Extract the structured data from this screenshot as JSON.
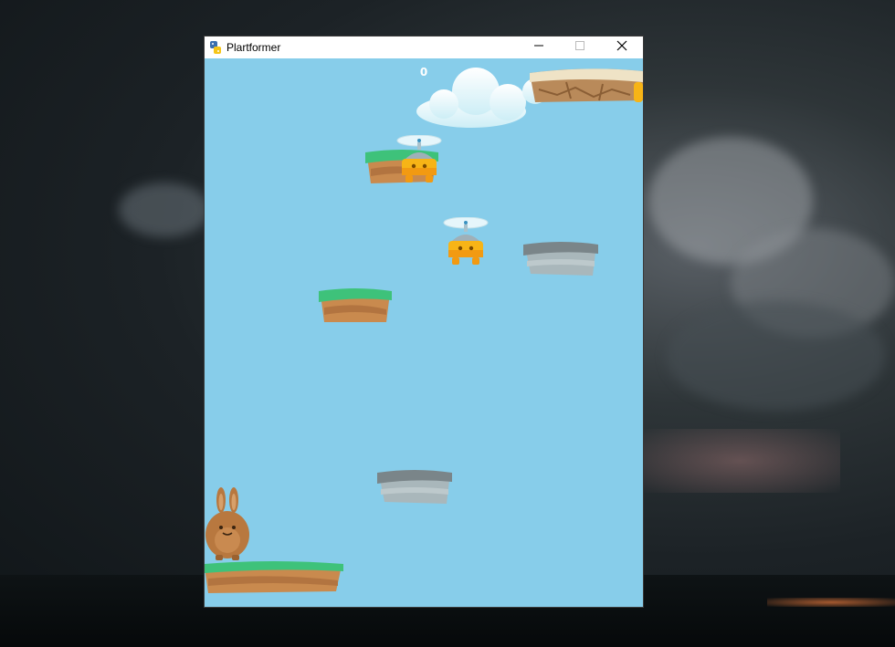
{
  "window": {
    "title": "Plartformer",
    "icon": "python-snake-icon",
    "controls": [
      "minimize-icon",
      "maximize-icon",
      "close-icon"
    ]
  },
  "game": {
    "score": "0",
    "sky_color": "#87cdea",
    "entities": [
      {
        "kind": "player",
        "name": "bunny"
      },
      {
        "kind": "enemy",
        "name": "propeller-flyer"
      },
      {
        "kind": "enemy",
        "name": "propeller-flyer"
      },
      {
        "kind": "platform",
        "type": "grass"
      },
      {
        "kind": "platform",
        "type": "grass"
      },
      {
        "kind": "platform",
        "type": "grass"
      },
      {
        "kind": "platform",
        "type": "stone"
      },
      {
        "kind": "platform",
        "type": "stone"
      },
      {
        "kind": "platform",
        "type": "sand"
      },
      {
        "kind": "decoration",
        "name": "cloud"
      }
    ]
  }
}
